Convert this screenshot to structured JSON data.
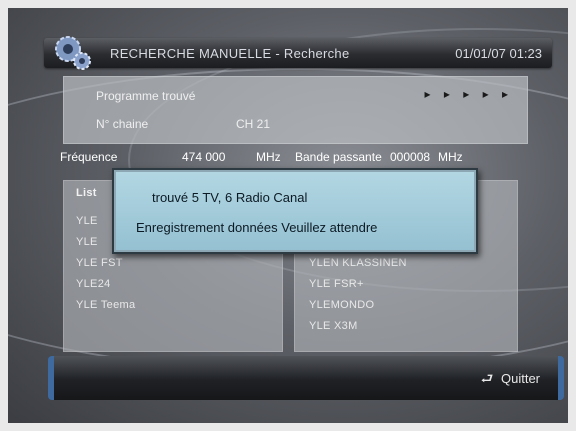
{
  "header": {
    "title": "RECHERCHE MANUELLE",
    "separator": "-",
    "subtitle": "Recherche",
    "datetime": "01/01/07 01:23"
  },
  "info": {
    "programme_label": "Programme trouvé",
    "channel_label": "N° chaine",
    "channel_value": "CH 21",
    "arrows": "▸ ▸ ▸ ▸ ▸"
  },
  "frequency": {
    "freq_label": "Fréquence",
    "freq_value": "474 000",
    "freq_unit": "MHz",
    "band_label": "Bande passante",
    "band_value": "000008",
    "band_unit": "MHz"
  },
  "list": {
    "header": "List",
    "tv_items": [
      "YLE",
      "YLE",
      "YLE FST",
      "YLE24",
      "YLE Teema"
    ],
    "radio_items": [
      "YLEN KLASSINEN",
      "YLE FSR+",
      "YLEMONDO",
      "YLE X3M"
    ]
  },
  "dialog": {
    "line1": "trouvé  5 TV,  6  Radio Canal",
    "line2": "Enregistrement données    Veuillez attendre"
  },
  "footer": {
    "quit_icon": "⮐",
    "quit_label": "Quitter"
  },
  "colors": {
    "dialog_bg": "#a5cfdc",
    "accent": "#3e6aa0"
  }
}
